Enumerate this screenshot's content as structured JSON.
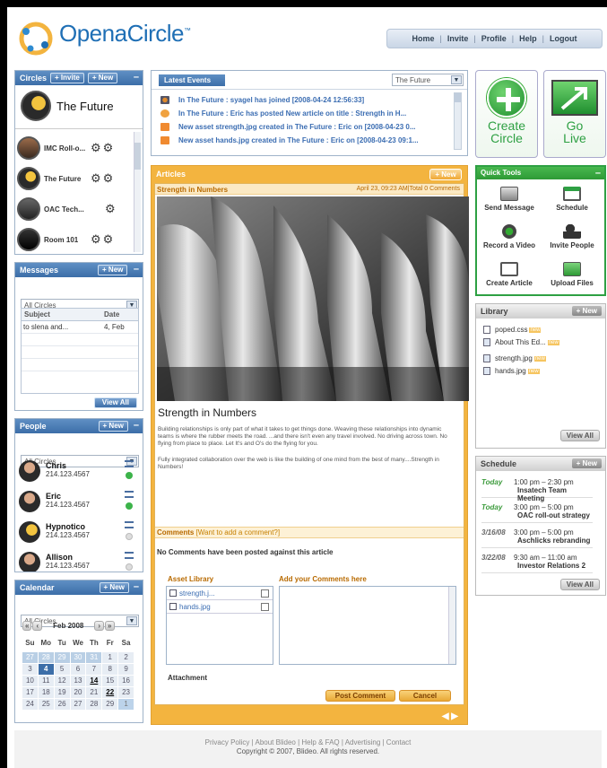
{
  "brand": {
    "name": "OpenaCircle",
    "tm": "™"
  },
  "topnav": [
    "Home",
    "Invite",
    "Profile",
    "Help",
    "Logout"
  ],
  "circles": {
    "title": "Circles",
    "invite": "+ Invite",
    "new": "+ New",
    "current": "The Future",
    "items": [
      {
        "name": "IMC Roll-o..."
      },
      {
        "name": "The Future"
      },
      {
        "name": "OAC Tech..."
      },
      {
        "name": "Room 101"
      }
    ]
  },
  "messages": {
    "title": "Messages",
    "new": "+ New",
    "filter": "All Circles",
    "col_subject": "Subject",
    "col_date": "Date",
    "rows": [
      {
        "subject": "to slena and...",
        "date": "4, Feb"
      }
    ],
    "view_all": "View All"
  },
  "people": {
    "title": "People",
    "new": "+ New",
    "filter": "All Circles",
    "items": [
      {
        "name": "Chris",
        "phone": "214.123.4567"
      },
      {
        "name": "Eric",
        "phone": "214.123.4567"
      },
      {
        "name": "Hypnotico",
        "phone": "214.123.4567"
      },
      {
        "name": "Allison",
        "phone": "214.123.4567"
      }
    ]
  },
  "calendar": {
    "title": "Calendar",
    "new": "+ New",
    "filter": "All Circles",
    "month": "Feb 2008",
    "days": [
      "Su",
      "Mo",
      "Tu",
      "We",
      "Th",
      "Fr",
      "Sa"
    ],
    "dates": [
      "27",
      "28",
      "29",
      "30",
      "31",
      "1",
      "2",
      "3",
      "4",
      "5",
      "6",
      "7",
      "8",
      "9",
      "10",
      "11",
      "12",
      "13",
      "14",
      "15",
      "16",
      "17",
      "18",
      "19",
      "20",
      "21",
      "22",
      "23",
      "24",
      "25",
      "26",
      "27",
      "28",
      "29",
      "1"
    ]
  },
  "events": {
    "title": "Latest Events",
    "filter": "The Future",
    "items": [
      "In The Future : syagel has joined [2008-04-24 12:56:33]",
      "In The Future : Eric has posted New article on title : Strength in H...",
      "New asset strength.jpg created in The Future : Eric on [2008-04-23 0...",
      "New asset hands.jpg created in The Future : Eric on [2008-04-23 09:1..."
    ]
  },
  "actions": {
    "create": "Create\nCircle",
    "golive": "Go\nLive"
  },
  "articles": {
    "title": "Articles",
    "new": "+ New",
    "article_title": "Strength in Numbers",
    "meta": "April 23, 09:23 AM|Total 0 Comments",
    "heading": "Strength in Numbers",
    "p1": "Building relationships is only part of what it takes to get things done. Weaving these relationships into dynamic teams is where the rubber meets the road. ...and there isn't even any travel involved. No driving across town. No flying from place to place. Let It's and O's do the flying for you.",
    "p2": "Fully integrated collaboration over the web is like the building of one mind from the best of many....Strength in Numbers!",
    "comments_label": "Comments",
    "comments_link": "[Want to add a comment?]",
    "no_comments": "No Comments have been posted against this article",
    "asset_library": "Asset Library",
    "assets": [
      "strength.j...",
      "hands.jpg"
    ],
    "add_comments": "Add your Comments here",
    "attachment": "Attachment",
    "post": "Post Comment",
    "cancel": "Cancel"
  },
  "quicktools": {
    "title": "Quick Tools",
    "items": [
      "Send Message",
      "Schedule",
      "Record a Video",
      "Invite People",
      "Create Article",
      "Upload Files"
    ]
  },
  "library": {
    "title": "Library",
    "new": "+ New",
    "items": [
      "poped.css",
      "About This Ed...",
      "strength.jpg",
      "hands.jpg"
    ],
    "view_all": "View All"
  },
  "schedule": {
    "title": "Schedule",
    "new": "+ New",
    "items": [
      {
        "day": "Today",
        "time": "1:00 pm – 2:30 pm",
        "title": "Insatech Team Meeting"
      },
      {
        "day": "Today",
        "time": "3:00 pm – 5:00 pm",
        "title": "OAC roll-out strategy"
      },
      {
        "day": "3/16/08",
        "time": "3:00 pm – 5:00 pm",
        "title": "Aschlicks rebranding"
      },
      {
        "day": "3/22/08",
        "time": "9:30 am – 11:00 am",
        "title": "Investor Relations 2"
      }
    ],
    "view_all": "View All"
  },
  "footer": {
    "links": "Privacy Policy | About Blideo | Help & FAQ | Advertising | Contact",
    "copyright": "Copyright © 2007, Blideo. All rights reserved."
  },
  "colors": {
    "brand_blue": "#3c6ea8",
    "orange": "#f3b43f",
    "green": "#2ea043"
  }
}
